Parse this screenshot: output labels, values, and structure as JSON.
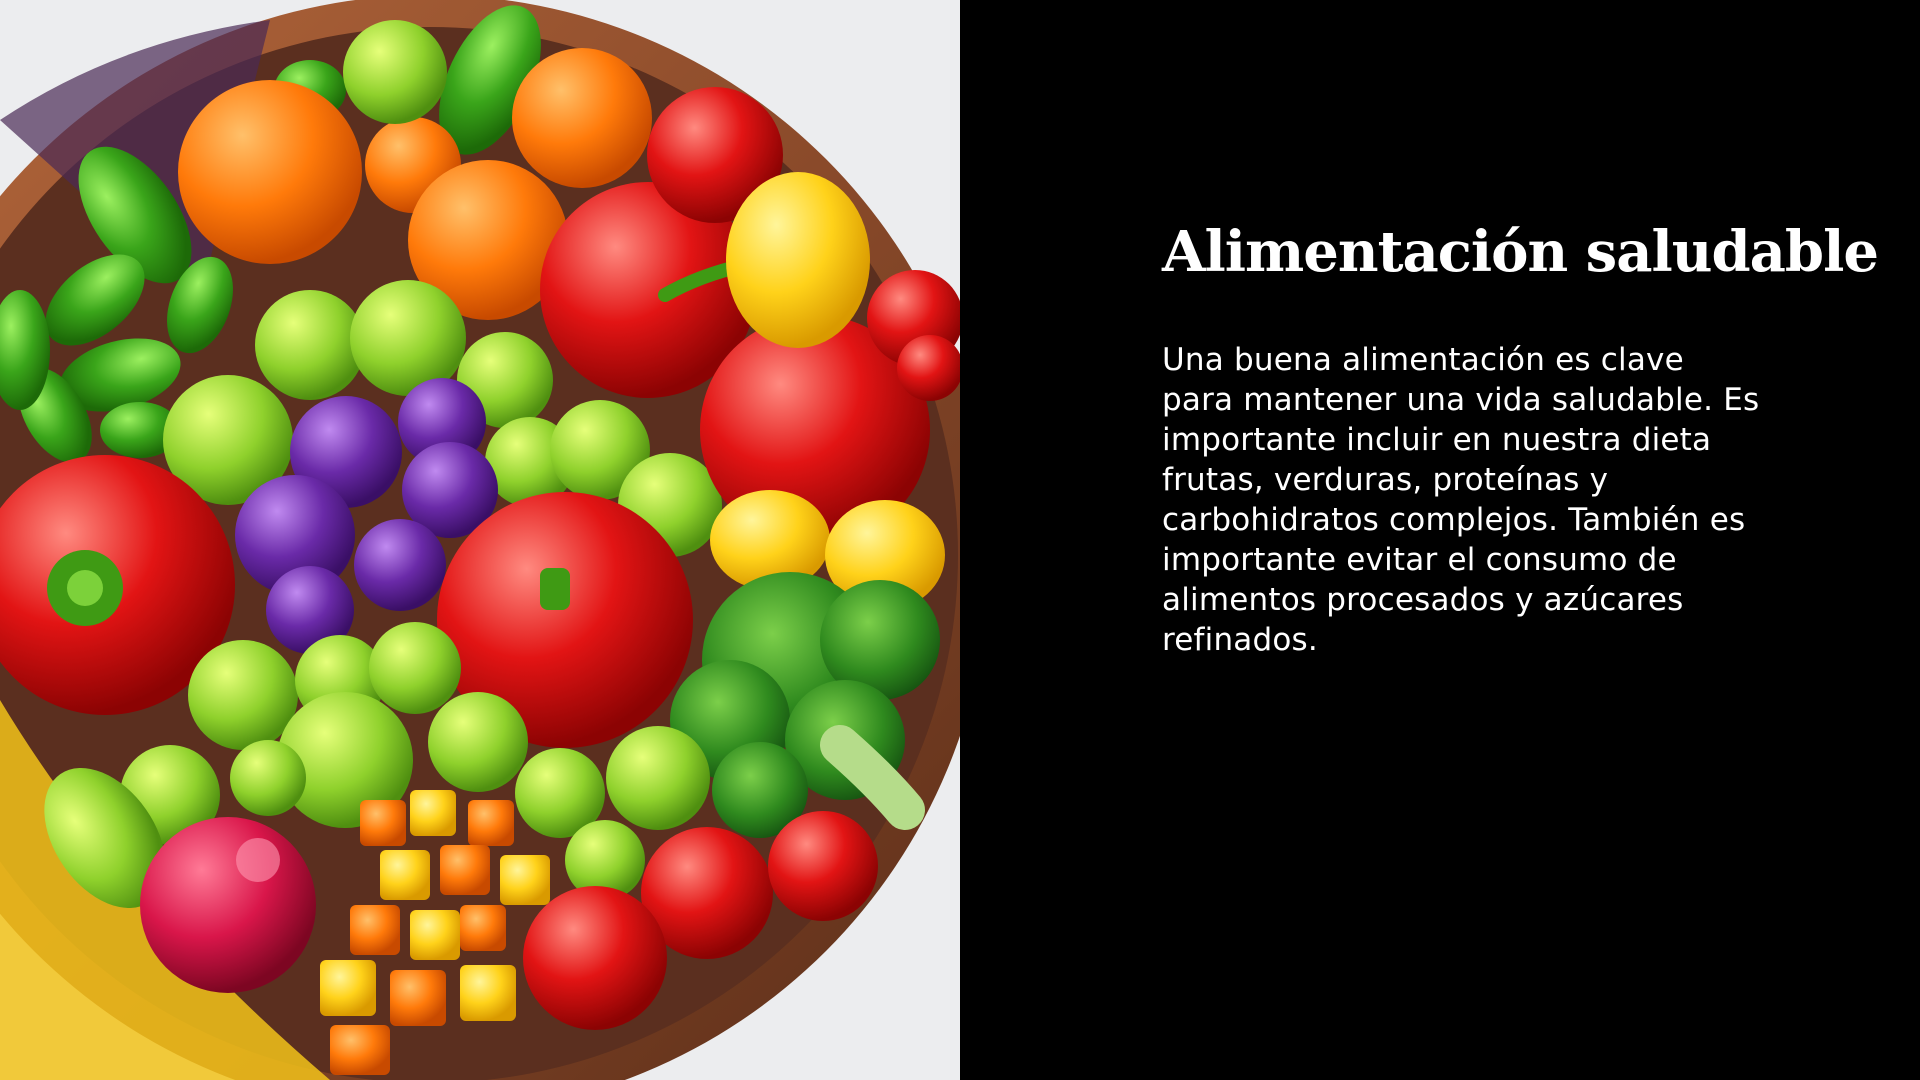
{
  "slide": {
    "title": "Alimentación saludable",
    "body": "Una buena alimentación es clave para mantener una vida saludable. Es importante incluir en nuestra dieta frutas, verduras, proteínas y carbohidratos complejos. También es importante evitar el consumo de alimentos procesados y azúcares refinados."
  },
  "image": {
    "subject": "bowl-of-fruits-and-vegetables"
  },
  "colors": {
    "background": "#000000",
    "text": "#ffffff",
    "image_backdrop": "#ecedef",
    "bowl": "#8a4a2a"
  }
}
